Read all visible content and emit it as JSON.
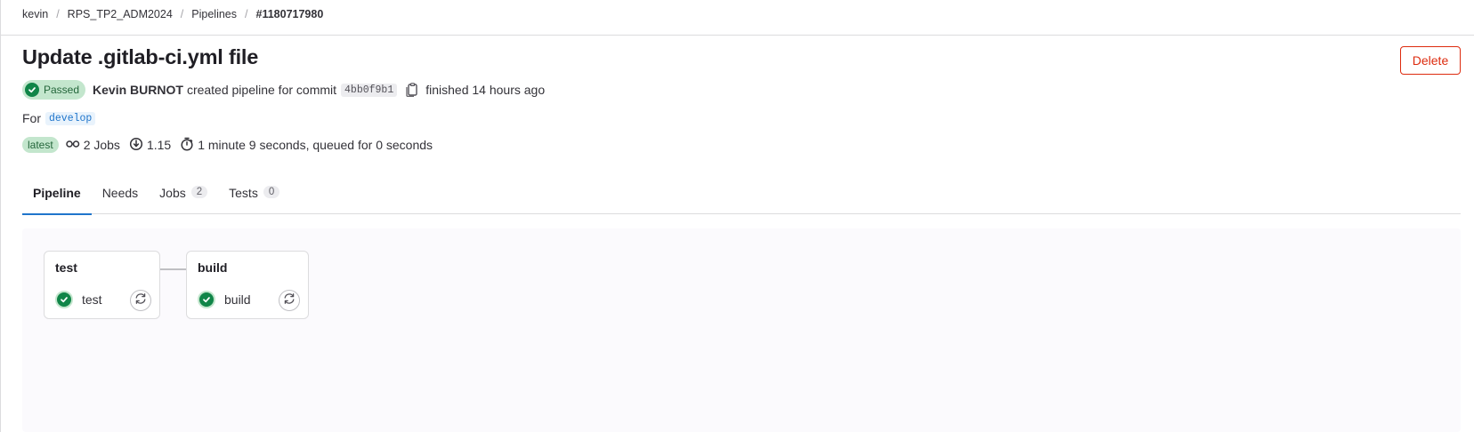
{
  "breadcrumb": {
    "items": [
      "kevin",
      "RPS_TP2_ADM2024",
      "Pipelines"
    ],
    "current": "#1180717980",
    "separator": "/"
  },
  "header": {
    "title": "Update .gitlab-ci.yml file",
    "delete_label": "Delete"
  },
  "meta": {
    "status": "Passed",
    "author": "Kevin BURNOT",
    "action_text": "created pipeline for commit",
    "sha": "4bb0f9b1",
    "finished_text": "finished 14 hours ago"
  },
  "ref": {
    "prefix": "For",
    "branch": "develop"
  },
  "stats": {
    "latest_label": "latest",
    "jobs_text": "2 Jobs",
    "compute_text": "1.15",
    "duration_text": "1 minute 9 seconds, queued for 0 seconds"
  },
  "tabs": [
    {
      "label": "Pipeline",
      "count": null
    },
    {
      "label": "Needs",
      "count": null
    },
    {
      "label": "Jobs",
      "count": "2"
    },
    {
      "label": "Tests",
      "count": "0"
    }
  ],
  "graph": {
    "stages": [
      {
        "title": "test",
        "job": "test",
        "status": "success"
      },
      {
        "title": "build",
        "job": "build",
        "status": "success"
      }
    ]
  },
  "colors": {
    "success": "#108548",
    "accent": "#1f75cb",
    "danger": "#dd2b0e"
  }
}
